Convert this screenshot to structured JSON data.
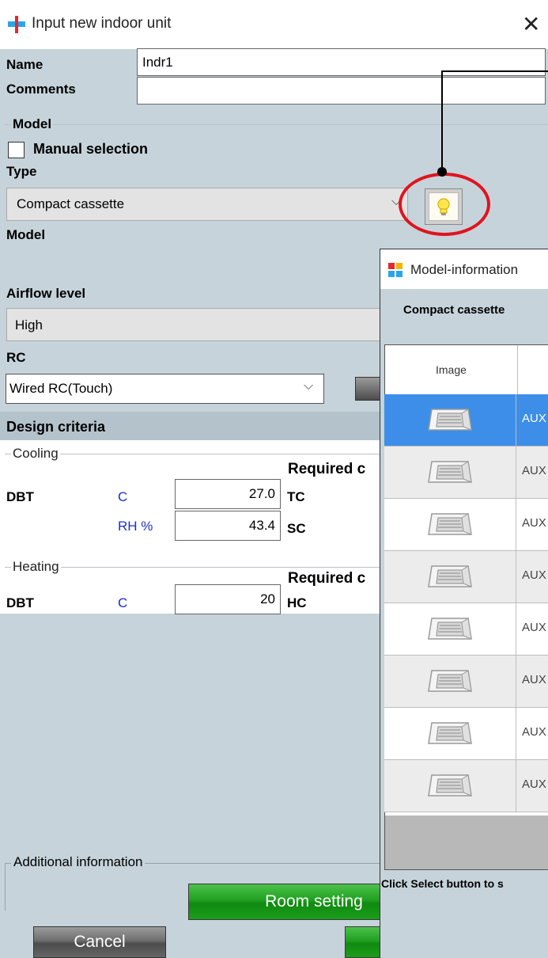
{
  "dialog": {
    "title": "Input new indoor unit",
    "close_icon": "close-icon",
    "name_label": "Name",
    "name_value": "Indr1",
    "comments_label": "Comments",
    "comments_value": "",
    "model_section": "Model",
    "manual_selection_label": "Manual selection",
    "manual_selection_checked": false,
    "type_label": "Type",
    "type_value": "Compact cassette",
    "model_label": "Model",
    "model_value": "",
    "lightbulb_icon": "lightbulb-icon",
    "airflow_label": "Airflow level",
    "airflow_value": "High",
    "rc_label": "RC",
    "rc_value": "Wired RC(Touch)",
    "design_criteria": "Design criteria",
    "cooling": {
      "label": "Cooling",
      "required": "Required c",
      "dbt_label": "DBT",
      "dbt_unit": "C",
      "dbt_value": "27.0",
      "tc_label": "TC",
      "rh_unit": "RH %",
      "rh_value": "43.4",
      "sc_label": "SC"
    },
    "heating": {
      "label": "Heating",
      "required": "Required c",
      "dbt_label": "DBT",
      "dbt_unit": "C",
      "dbt_value": "20",
      "hc_label": "HC"
    },
    "additional_info": "Additional information",
    "room_setting": "Room setting",
    "cancel": "Cancel"
  },
  "popup": {
    "title": "Model-information",
    "type_value": "Compact cassette",
    "col_image": "Image",
    "rows": [
      {
        "name": "AUX"
      },
      {
        "name": "AUX"
      },
      {
        "name": "AUX"
      },
      {
        "name": "AUX"
      },
      {
        "name": "AUX"
      },
      {
        "name": "AUX"
      },
      {
        "name": "AUX"
      },
      {
        "name": "AUX"
      }
    ],
    "hint": "Click Select button to s",
    "selected_row": 0
  },
  "colors": {
    "accent_select": "#3d8ee8",
    "section_bg": "#c6d3da",
    "highlight_circle": "#e0141e",
    "green_button": "#21a021"
  }
}
